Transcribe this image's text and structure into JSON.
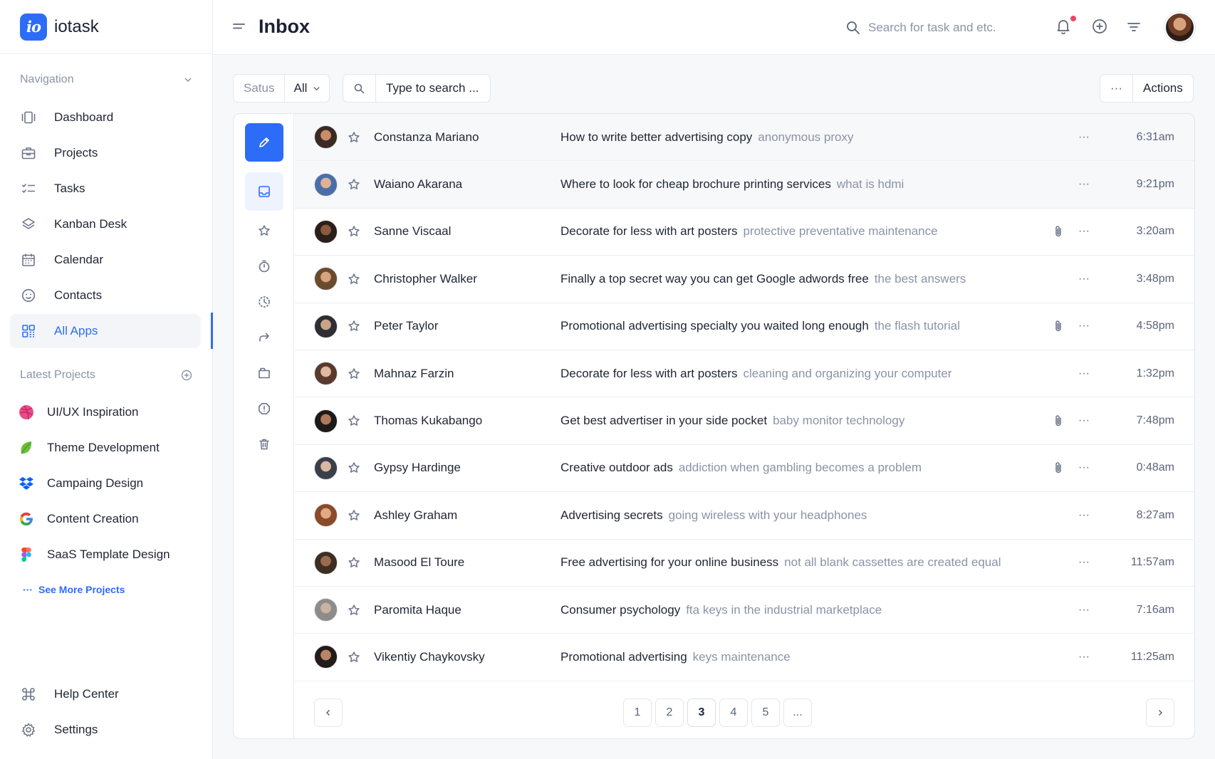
{
  "brand": {
    "logo_text": "io",
    "name": "iotask"
  },
  "sidebar": {
    "nav_heading": "Navigation",
    "nav_items": [
      {
        "label": "Dashboard",
        "icon": "dashboard-icon"
      },
      {
        "label": "Projects",
        "icon": "briefcase-icon"
      },
      {
        "label": "Tasks",
        "icon": "checklist-icon"
      },
      {
        "label": "Kanban Desk",
        "icon": "layers-icon"
      },
      {
        "label": "Calendar",
        "icon": "calendar-icon"
      },
      {
        "label": "Contacts",
        "icon": "smile-icon"
      },
      {
        "label": "All Apps",
        "icon": "grid-icon",
        "active": true
      }
    ],
    "projects_heading": "Latest Projects",
    "projects": [
      {
        "label": "UI/UX Inspiration",
        "icon": "dribbble-icon",
        "color": "#ea4c89"
      },
      {
        "label": "Theme Development",
        "icon": "leaf-icon",
        "color": "#6cbf3c"
      },
      {
        "label": "Campaing Design",
        "icon": "dropbox-icon",
        "color": "#0061fe"
      },
      {
        "label": "Content Creation",
        "icon": "google-icon",
        "color": "#4285f4"
      },
      {
        "label": "SaaS Template Design",
        "icon": "figma-icon",
        "color": "#f24e1e"
      }
    ],
    "see_more": "See More Projects",
    "help_label": "Help Center",
    "settings_label": "Settings"
  },
  "header": {
    "title": "Inbox",
    "search_placeholder": "Search for task and etc."
  },
  "filters": {
    "status_label": "Satus",
    "status_value": "All",
    "search_placeholder": "Type to search ...",
    "more_label": "···",
    "actions_label": "Actions"
  },
  "messages": [
    {
      "sender": "Constanza Mariano",
      "subject": "How to write better advertising copy",
      "preview": "anonymous proxy",
      "time": "6:31am",
      "attachment": false
    },
    {
      "sender": "Waiano Akarana",
      "subject": "Where to look for cheap brochure printing services",
      "preview": "what is hdmi",
      "time": "9:21pm",
      "attachment": false
    },
    {
      "sender": "Sanne Viscaal",
      "subject": "Decorate for less with art posters",
      "preview": "protective preventative maintenance",
      "time": "3:20am",
      "attachment": true
    },
    {
      "sender": "Christopher Walker",
      "subject": "Finally a top secret way you can get Google adwords free",
      "preview": "the best answers",
      "time": "3:48pm",
      "attachment": false
    },
    {
      "sender": "Peter Taylor",
      "subject": "Promotional advertising specialty you waited long enough",
      "preview": "the flash tutorial",
      "time": "4:58pm",
      "attachment": true
    },
    {
      "sender": "Mahnaz Farzin",
      "subject": "Decorate for less with art posters",
      "preview": "cleaning and organizing your computer",
      "time": "1:32pm",
      "attachment": false
    },
    {
      "sender": "Thomas Kukabango",
      "subject": "Get best advertiser in your side pocket",
      "preview": "baby monitor technology",
      "time": "7:48pm",
      "attachment": true
    },
    {
      "sender": "Gypsy Hardinge",
      "subject": "Creative outdoor ads",
      "preview": "addiction when gambling becomes a problem",
      "time": "0:48am",
      "attachment": true
    },
    {
      "sender": "Ashley Graham",
      "subject": "Advertising secrets",
      "preview": "going wireless with your headphones",
      "time": "8:27am",
      "attachment": false
    },
    {
      "sender": "Masood El Toure",
      "subject": "Free advertising for your online business",
      "preview": "not all blank cassettes are created equal",
      "time": "11:57am",
      "attachment": false
    },
    {
      "sender": "Paromita Haque",
      "subject": "Consumer psychology",
      "preview": "fta keys  in the industrial marketplace",
      "time": "7:16am",
      "attachment": false
    },
    {
      "sender": "Vikentiy Chaykovsky",
      "subject": "Promotional advertising",
      "preview": "keys maintenance",
      "time": "11:25am",
      "attachment": false
    }
  ],
  "pagination": {
    "pages": [
      "1",
      "2",
      "3",
      "4",
      "5",
      "..."
    ],
    "current": "3"
  },
  "colors": {
    "accent": "#2d6cf6",
    "notification": "#ef4466"
  }
}
